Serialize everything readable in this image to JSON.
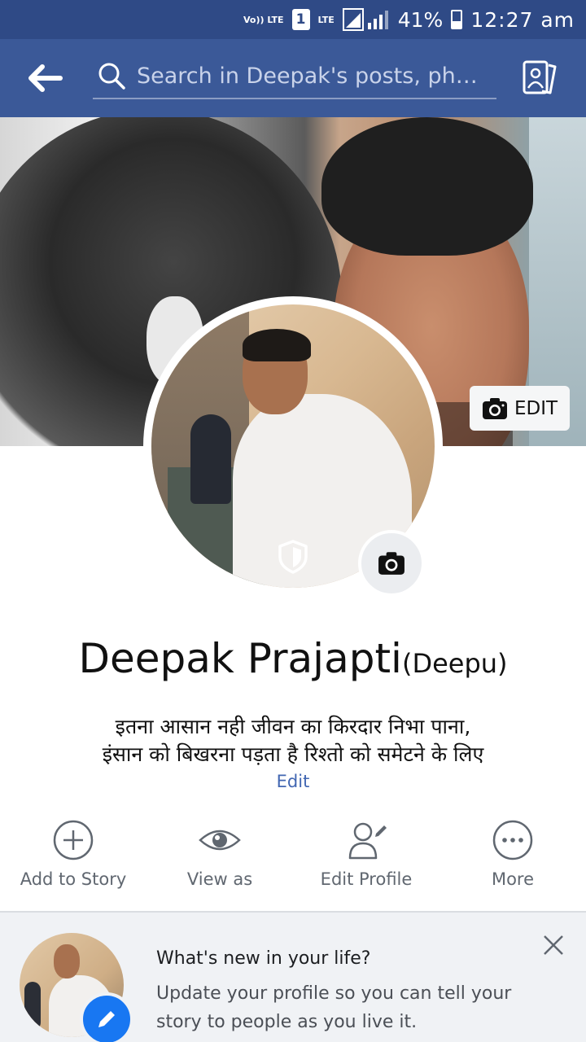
{
  "status_bar": {
    "volte": "Vo)) LTE",
    "sim": "1",
    "network": "LTE",
    "battery": "41%",
    "battery_level": 0.41,
    "time": "12:27 am"
  },
  "app_bar": {
    "back_icon": "back-arrow-icon",
    "search_placeholder": "Search in Deepak's posts, phot...",
    "photos_icon": "profile-photos-icon"
  },
  "cover": {
    "edit_label": "EDIT"
  },
  "profile": {
    "name": "Deepak Prajapti",
    "nickname": "(Deepu)",
    "bio_line1": "इतना आसान नही जीवन का किरदार निभा पाना,",
    "bio_line2": "इंसान को बिखरना पड़ता है रिश्तो को समेटने के लिए",
    "bio_edit": "Edit"
  },
  "actions": [
    {
      "label": "Add to Story",
      "icon": "add-circle-icon"
    },
    {
      "label": "View as",
      "icon": "eye-icon"
    },
    {
      "label": "Edit Profile",
      "icon": "edit-profile-icon"
    },
    {
      "label": "More",
      "icon": "more-dots-icon"
    }
  ],
  "prompt": {
    "title": "What's new in your life?",
    "body": "Update your profile so you can tell your story to people as you live it."
  },
  "colors": {
    "status_bar": "#2f4a86",
    "app_bar": "#3b5998",
    "link": "#4267b2",
    "pencil": "#1877f2"
  }
}
